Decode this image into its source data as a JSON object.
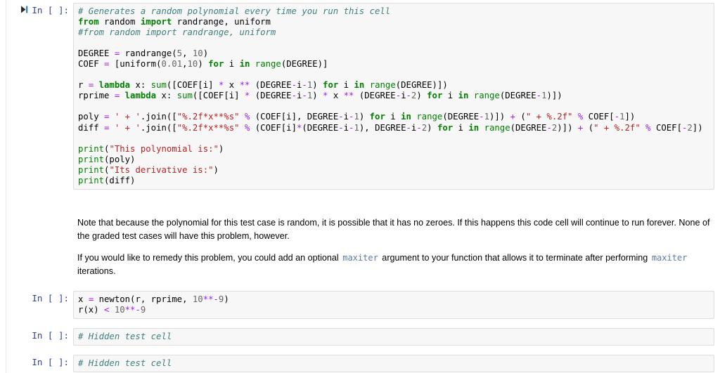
{
  "app": {
    "type": "jupyter-notebook"
  },
  "cells": [
    {
      "id": "cell-polynomial-generator",
      "prompt": "In [ ]:",
      "has_run_icon": true,
      "kind": "code",
      "code_lines": [
        [
          {
            "t": "# Generates a random polynomial every time you run this cell",
            "c": "c"
          }
        ],
        [
          {
            "t": "from",
            "c": "k"
          },
          {
            "t": " random ",
            "c": "n"
          },
          {
            "t": "import",
            "c": "k"
          },
          {
            "t": " randrange, uniform",
            "c": "n"
          }
        ],
        [
          {
            "t": "#from random import randrange, uniform",
            "c": "c"
          }
        ],
        [
          {
            "t": "",
            "c": "n"
          }
        ],
        [
          {
            "t": "DEGREE ",
            "c": "n"
          },
          {
            "t": "=",
            "c": "o"
          },
          {
            "t": " randrange(",
            "c": "n"
          },
          {
            "t": "5",
            "c": "m"
          },
          {
            "t": ", ",
            "c": "n"
          },
          {
            "t": "10",
            "c": "m"
          },
          {
            "t": ")",
            "c": "n"
          }
        ],
        [
          {
            "t": "COEF ",
            "c": "n"
          },
          {
            "t": "=",
            "c": "o"
          },
          {
            "t": " [uniform(",
            "c": "n"
          },
          {
            "t": "0.01",
            "c": "m"
          },
          {
            "t": ",",
            "c": "n"
          },
          {
            "t": "10",
            "c": "m"
          },
          {
            "t": ") ",
            "c": "n"
          },
          {
            "t": "for",
            "c": "k"
          },
          {
            "t": " i ",
            "c": "n"
          },
          {
            "t": "in",
            "c": "k"
          },
          {
            "t": " ",
            "c": "n"
          },
          {
            "t": "range",
            "c": "nb"
          },
          {
            "t": "(DEGREE)]",
            "c": "n"
          }
        ],
        [
          {
            "t": "",
            "c": "n"
          }
        ],
        [
          {
            "t": "r ",
            "c": "n"
          },
          {
            "t": "=",
            "c": "o"
          },
          {
            "t": " ",
            "c": "n"
          },
          {
            "t": "lambda",
            "c": "k"
          },
          {
            "t": " x: ",
            "c": "n"
          },
          {
            "t": "sum",
            "c": "nb"
          },
          {
            "t": "([COEF[i] ",
            "c": "n"
          },
          {
            "t": "*",
            "c": "o"
          },
          {
            "t": " x ",
            "c": "n"
          },
          {
            "t": "**",
            "c": "o"
          },
          {
            "t": " (DEGREE",
            "c": "n"
          },
          {
            "t": "-",
            "c": "o"
          },
          {
            "t": "i",
            "c": "n"
          },
          {
            "t": "-",
            "c": "o"
          },
          {
            "t": "1",
            "c": "m"
          },
          {
            "t": ") ",
            "c": "n"
          },
          {
            "t": "for",
            "c": "k"
          },
          {
            "t": " i ",
            "c": "n"
          },
          {
            "t": "in",
            "c": "k"
          },
          {
            "t": " ",
            "c": "n"
          },
          {
            "t": "range",
            "c": "nb"
          },
          {
            "t": "(DEGREE)])",
            "c": "n"
          }
        ],
        [
          {
            "t": "rprime ",
            "c": "n"
          },
          {
            "t": "=",
            "c": "o"
          },
          {
            "t": " ",
            "c": "n"
          },
          {
            "t": "lambda",
            "c": "k"
          },
          {
            "t": " x: ",
            "c": "n"
          },
          {
            "t": "sum",
            "c": "nb"
          },
          {
            "t": "([COEF[i] ",
            "c": "n"
          },
          {
            "t": "*",
            "c": "o"
          },
          {
            "t": " (DEGREE",
            "c": "n"
          },
          {
            "t": "-",
            "c": "o"
          },
          {
            "t": "i",
            "c": "n"
          },
          {
            "t": "-",
            "c": "o"
          },
          {
            "t": "1",
            "c": "m"
          },
          {
            "t": ") ",
            "c": "n"
          },
          {
            "t": "*",
            "c": "o"
          },
          {
            "t": " x ",
            "c": "n"
          },
          {
            "t": "**",
            "c": "o"
          },
          {
            "t": " (DEGREE",
            "c": "n"
          },
          {
            "t": "-",
            "c": "o"
          },
          {
            "t": "i",
            "c": "n"
          },
          {
            "t": "-",
            "c": "o"
          },
          {
            "t": "2",
            "c": "m"
          },
          {
            "t": ") ",
            "c": "n"
          },
          {
            "t": "for",
            "c": "k"
          },
          {
            "t": " i ",
            "c": "n"
          },
          {
            "t": "in",
            "c": "k"
          },
          {
            "t": " ",
            "c": "n"
          },
          {
            "t": "range",
            "c": "nb"
          },
          {
            "t": "(DEGREE",
            "c": "n"
          },
          {
            "t": "-",
            "c": "o"
          },
          {
            "t": "1",
            "c": "m"
          },
          {
            "t": ")])",
            "c": "n"
          }
        ],
        [
          {
            "t": "",
            "c": "n"
          }
        ],
        [
          {
            "t": "poly ",
            "c": "n"
          },
          {
            "t": "=",
            "c": "o"
          },
          {
            "t": " ",
            "c": "n"
          },
          {
            "t": "' + '",
            "c": "s"
          },
          {
            "t": ".join([",
            "c": "n"
          },
          {
            "t": "\"%.2f*x**%s\"",
            "c": "s"
          },
          {
            "t": " ",
            "c": "n"
          },
          {
            "t": "%",
            "c": "o"
          },
          {
            "t": " (COEF[i], DEGREE",
            "c": "n"
          },
          {
            "t": "-",
            "c": "o"
          },
          {
            "t": "i",
            "c": "n"
          },
          {
            "t": "-",
            "c": "o"
          },
          {
            "t": "1",
            "c": "m"
          },
          {
            "t": ") ",
            "c": "n"
          },
          {
            "t": "for",
            "c": "k"
          },
          {
            "t": " i ",
            "c": "n"
          },
          {
            "t": "in",
            "c": "k"
          },
          {
            "t": " ",
            "c": "n"
          },
          {
            "t": "range",
            "c": "nb"
          },
          {
            "t": "(DEGREE",
            "c": "n"
          },
          {
            "t": "-",
            "c": "o"
          },
          {
            "t": "1",
            "c": "m"
          },
          {
            "t": ")]) ",
            "c": "n"
          },
          {
            "t": "+",
            "c": "o"
          },
          {
            "t": " (",
            "c": "n"
          },
          {
            "t": "\" + %.2f\"",
            "c": "s"
          },
          {
            "t": " ",
            "c": "n"
          },
          {
            "t": "%",
            "c": "o"
          },
          {
            "t": " COEF[",
            "c": "n"
          },
          {
            "t": "-",
            "c": "o"
          },
          {
            "t": "1",
            "c": "m"
          },
          {
            "t": "])",
            "c": "n"
          }
        ],
        [
          {
            "t": "diff ",
            "c": "n"
          },
          {
            "t": "=",
            "c": "o"
          },
          {
            "t": " ",
            "c": "n"
          },
          {
            "t": "' + '",
            "c": "s"
          },
          {
            "t": ".join([",
            "c": "n"
          },
          {
            "t": "\"%.2f*x**%s\"",
            "c": "s"
          },
          {
            "t": " ",
            "c": "n"
          },
          {
            "t": "%",
            "c": "o"
          },
          {
            "t": " (COEF[i]",
            "c": "n"
          },
          {
            "t": "*",
            "c": "o"
          },
          {
            "t": "(DEGREE",
            "c": "n"
          },
          {
            "t": "-",
            "c": "o"
          },
          {
            "t": "i",
            "c": "n"
          },
          {
            "t": "-",
            "c": "o"
          },
          {
            "t": "1",
            "c": "m"
          },
          {
            "t": "), DEGREE",
            "c": "n"
          },
          {
            "t": "-",
            "c": "o"
          },
          {
            "t": "i",
            "c": "n"
          },
          {
            "t": "-",
            "c": "o"
          },
          {
            "t": "2",
            "c": "m"
          },
          {
            "t": ") ",
            "c": "n"
          },
          {
            "t": "for",
            "c": "k"
          },
          {
            "t": " i ",
            "c": "n"
          },
          {
            "t": "in",
            "c": "k"
          },
          {
            "t": " ",
            "c": "n"
          },
          {
            "t": "range",
            "c": "nb"
          },
          {
            "t": "(DEGREE",
            "c": "n"
          },
          {
            "t": "-",
            "c": "o"
          },
          {
            "t": "2",
            "c": "m"
          },
          {
            "t": ")]) ",
            "c": "n"
          },
          {
            "t": "+",
            "c": "o"
          },
          {
            "t": " (",
            "c": "n"
          },
          {
            "t": "\" + %.2f\"",
            "c": "s"
          },
          {
            "t": " ",
            "c": "n"
          },
          {
            "t": "%",
            "c": "o"
          },
          {
            "t": " COEF[",
            "c": "n"
          },
          {
            "t": "-",
            "c": "o"
          },
          {
            "t": "2",
            "c": "m"
          },
          {
            "t": "])",
            "c": "n"
          }
        ],
        [
          {
            "t": "",
            "c": "n"
          }
        ],
        [
          {
            "t": "print",
            "c": "nb"
          },
          {
            "t": "(",
            "c": "n"
          },
          {
            "t": "\"This polynomial is:\"",
            "c": "s"
          },
          {
            "t": ")",
            "c": "n"
          }
        ],
        [
          {
            "t": "print",
            "c": "nb"
          },
          {
            "t": "(poly)",
            "c": "n"
          }
        ],
        [
          {
            "t": "print",
            "c": "nb"
          },
          {
            "t": "(",
            "c": "n"
          },
          {
            "t": "\"Its derivative is:\"",
            "c": "s"
          },
          {
            "t": ")",
            "c": "n"
          }
        ],
        [
          {
            "t": "print",
            "c": "nb"
          },
          {
            "t": "(diff)",
            "c": "n"
          }
        ]
      ]
    },
    {
      "id": "cell-newton-call",
      "prompt": "In [ ]:",
      "has_run_icon": false,
      "kind": "code",
      "code_lines": [
        [
          {
            "t": "x ",
            "c": "n"
          },
          {
            "t": "=",
            "c": "o"
          },
          {
            "t": " newton(r, rprime, ",
            "c": "n"
          },
          {
            "t": "10",
            "c": "m"
          },
          {
            "t": "**",
            "c": "o"
          },
          {
            "t": "-",
            "c": "o"
          },
          {
            "t": "9",
            "c": "m"
          },
          {
            "t": ")",
            "c": "n"
          }
        ],
        [
          {
            "t": "r(x) ",
            "c": "n"
          },
          {
            "t": "<",
            "c": "o"
          },
          {
            "t": " ",
            "c": "n"
          },
          {
            "t": "10",
            "c": "m"
          },
          {
            "t": "**",
            "c": "o"
          },
          {
            "t": "-",
            "c": "o"
          },
          {
            "t": "9",
            "c": "m"
          }
        ]
      ]
    },
    {
      "id": "cell-hidden-test-1",
      "prompt": "In [ ]:",
      "has_run_icon": false,
      "kind": "code",
      "code_lines": [
        [
          {
            "t": "# Hidden test cell",
            "c": "c"
          }
        ]
      ]
    },
    {
      "id": "cell-hidden-test-2",
      "prompt": "In [ ]:",
      "has_run_icon": false,
      "kind": "code",
      "code_lines": [
        [
          {
            "t": "# Hidden test cell",
            "c": "c"
          }
        ]
      ]
    }
  ],
  "markdown": {
    "paragraph_1": "Note that because the polynomial for this test case is random, it is possible that it has no zeroes. If this happens this code cell will continue to run forever. None of the graded test cases will have this problem, however.",
    "paragraph_2_part_1": "If you would like to remedy this problem, you could add an optional ",
    "paragraph_2_code_1": "maxiter",
    "paragraph_2_part_2": " argument to your function that allows it to terminate after performing ",
    "paragraph_2_code_2": "maxiter",
    "paragraph_2_part_3": " iterations."
  },
  "colors": {
    "cell_background": "#f7f7f7",
    "cell_border": "#dddddd",
    "prompt_text": "#303f9f",
    "comment": "#408080",
    "keyword": "#008000",
    "string": "#ba2121",
    "operator": "#a020f0",
    "number": "#666666",
    "builtin": "#008000",
    "inline_code": "#5b7aa8",
    "page_background": "#ffffff"
  }
}
